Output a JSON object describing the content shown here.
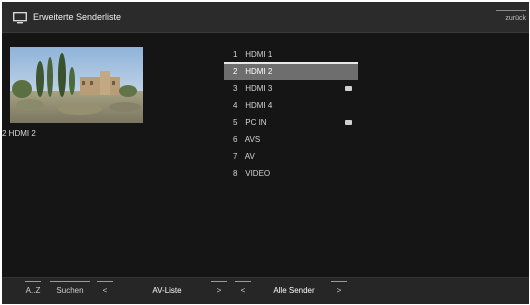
{
  "header": {
    "title": "Erweiterte Senderliste",
    "back_label": "zurück"
  },
  "preview": {
    "label": "2 HDMI 2"
  },
  "channels": [
    {
      "num": "1",
      "name": "HDMI 1",
      "selected": false,
      "badge": false
    },
    {
      "num": "2",
      "name": "HDMI 2",
      "selected": true,
      "badge": false
    },
    {
      "num": "3",
      "name": "HDMI 3",
      "selected": false,
      "badge": true
    },
    {
      "num": "4",
      "name": "HDMI 4",
      "selected": false,
      "badge": false
    },
    {
      "num": "5",
      "name": "PC IN",
      "selected": false,
      "badge": true
    },
    {
      "num": "6",
      "name": "AVS",
      "selected": false,
      "badge": false
    },
    {
      "num": "7",
      "name": "AV",
      "selected": false,
      "badge": false
    },
    {
      "num": "8",
      "name": "VIDEO",
      "selected": false,
      "badge": false
    }
  ],
  "footer": {
    "sort_label": "A..Z",
    "search_label": "Suchen",
    "list_prev": "<",
    "list_label": "AV-Liste",
    "list_next": ">",
    "filter_prev": "<",
    "filter_label": "Alle Sender",
    "filter_next": ">"
  },
  "colors": {
    "background": "#151515",
    "header": "#2b2b2b",
    "selection": "#6e6e6e"
  }
}
